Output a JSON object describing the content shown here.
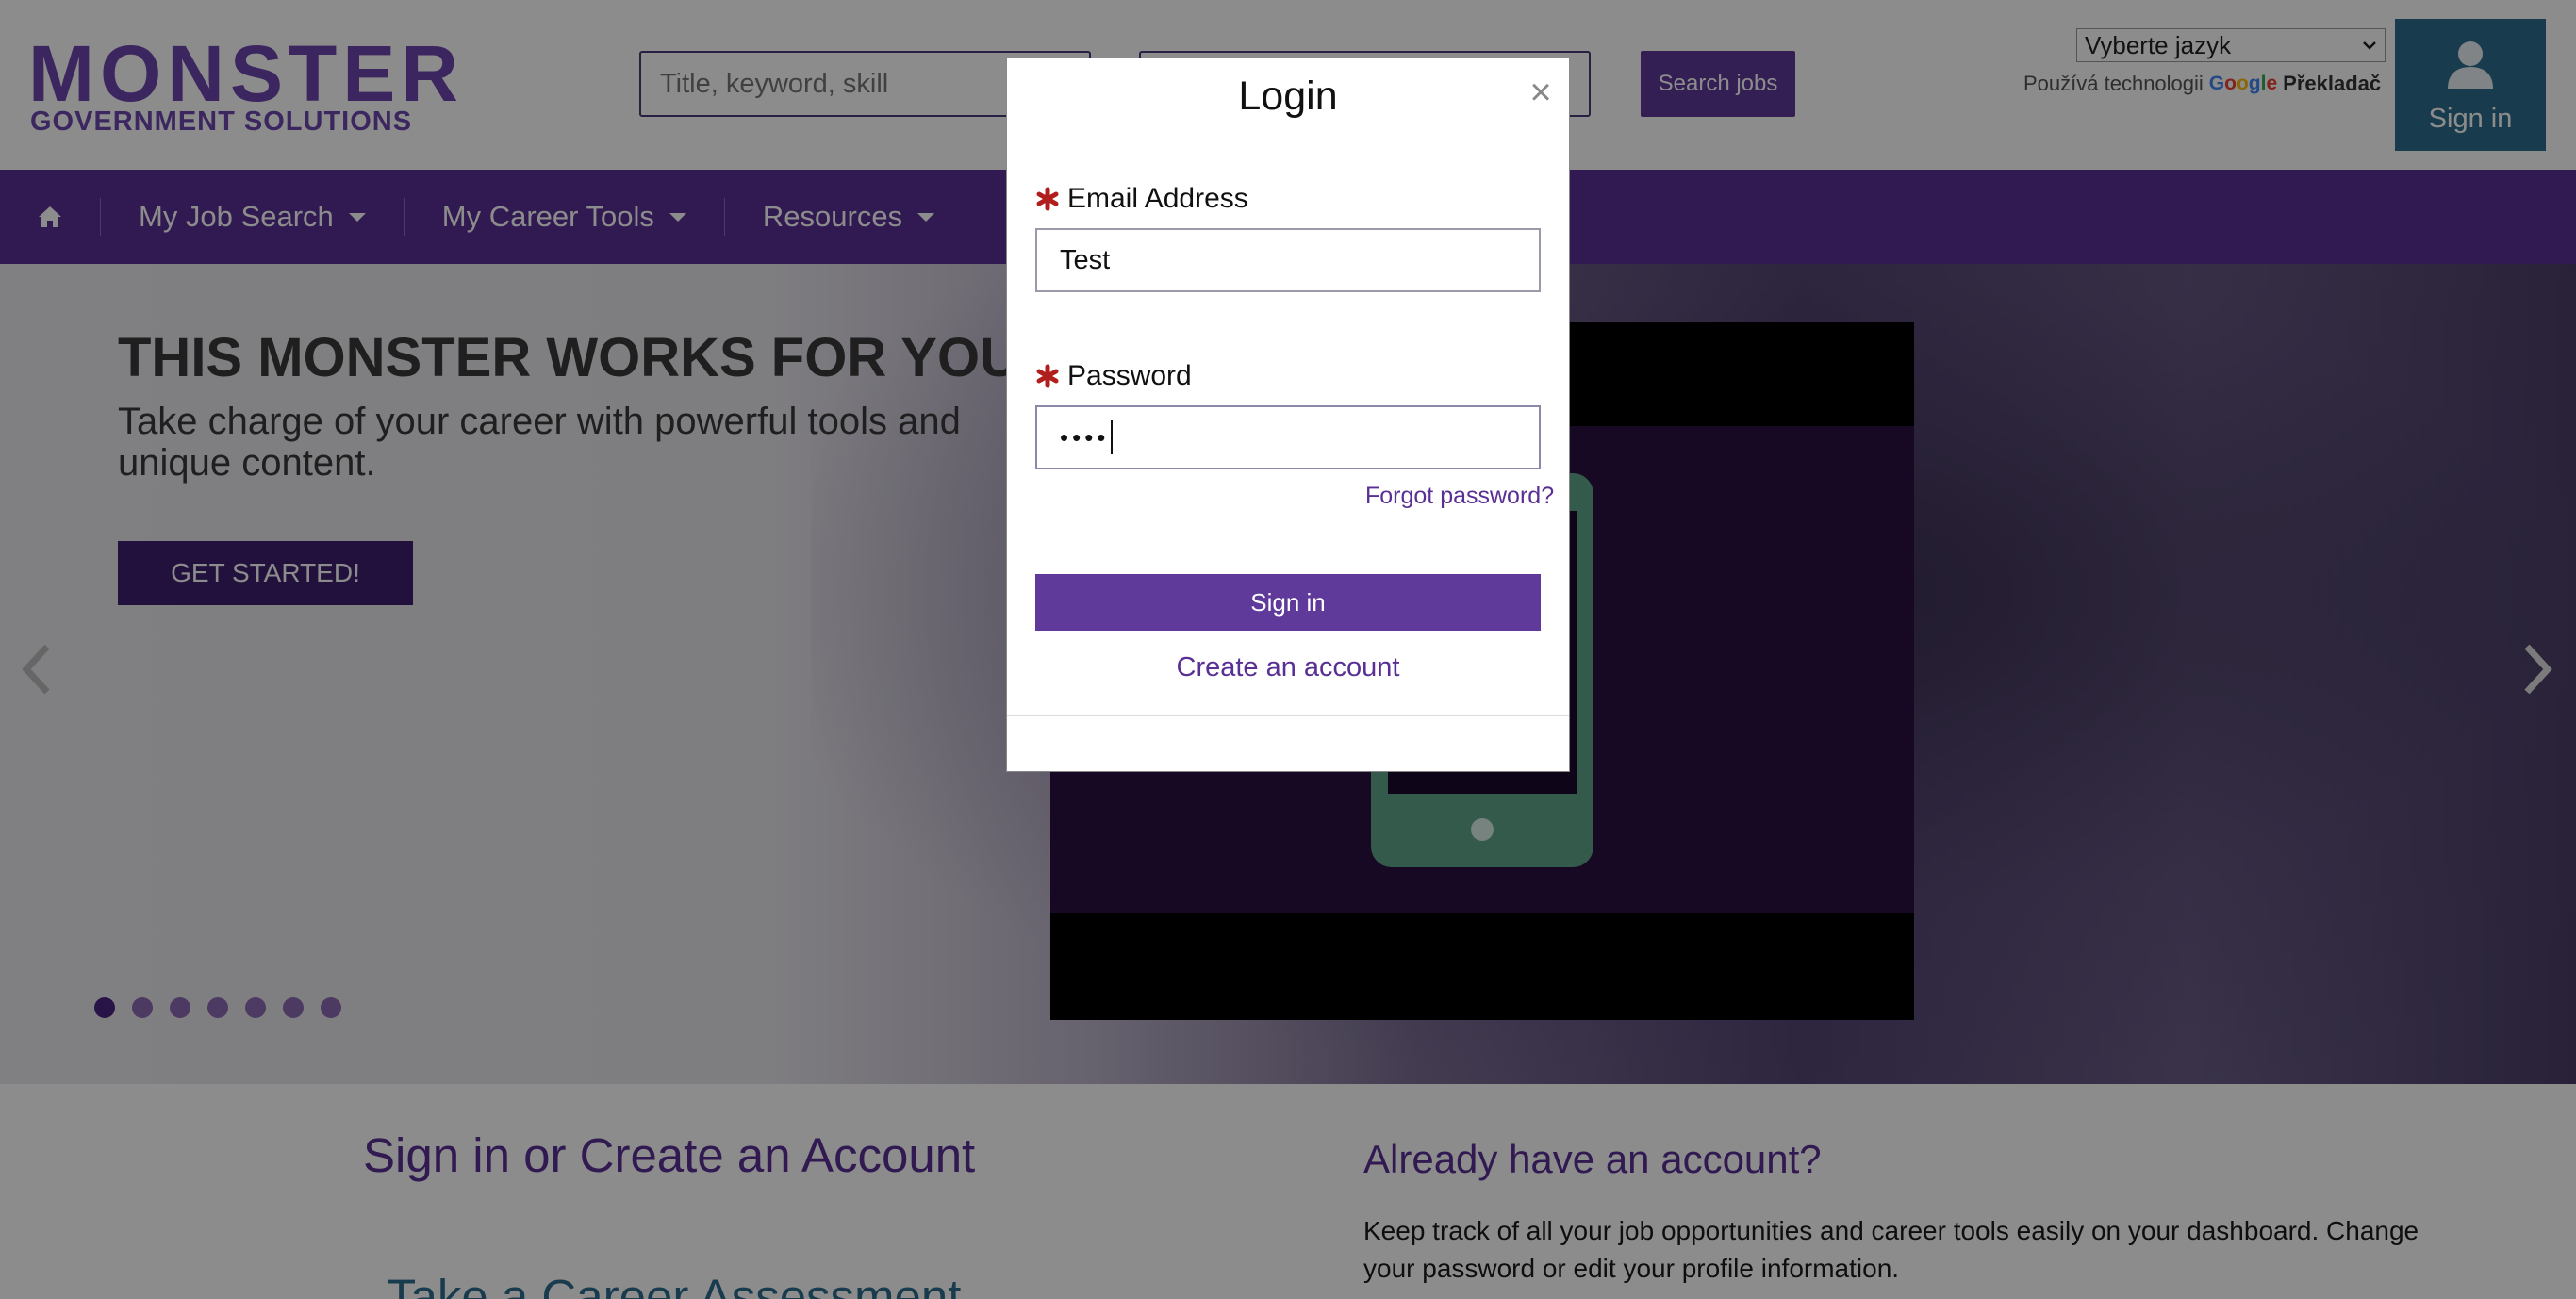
{
  "header": {
    "logo_main": "MONSTER",
    "logo_sub": "GOVERNMENT SOLUTIONS",
    "search_what_placeholder": "Title, keyword, skill",
    "search_where_placeholder": "",
    "search_button": "Search jobs",
    "language_select_value": "Vyberte jazyk",
    "powered_by": "Používá technologii",
    "google_letters": [
      "G",
      "o",
      "o",
      "g",
      "l",
      "e"
    ],
    "translate_label": "Překladač",
    "signin_tile_label": "Sign in",
    "signin_tile_color": "#2d6e8e"
  },
  "nav": {
    "items": [
      {
        "label": "My Job Search"
      },
      {
        "label": "My Career Tools"
      },
      {
        "label": "Resources"
      }
    ],
    "home_icon": "home-icon",
    "color": "#5a2f94"
  },
  "hero": {
    "title": "THIS MONSTER WORKS FOR YOU!",
    "subtitle": "Take charge of your career with powerful tools and unique content.",
    "cta_label": "GET STARTED!",
    "slide_count": 7,
    "active_slide": 1
  },
  "lower": {
    "left_title": "Sign in or Create an Account",
    "left_subtitle": "Take a Career Assessment",
    "right_title": "Already have an account?",
    "right_text": "Keep track of all your job opportunities and career tools easily on your dashboard. Change your password or edit your profile information."
  },
  "modal": {
    "title": "Login",
    "close_glyph": "×",
    "email_label": "Email Address",
    "email_value": "Test",
    "password_label": "Password",
    "password_masked": "••••",
    "forgot_label": "Forgot password?",
    "signin_label": "Sign in",
    "create_account_label": "Create an account",
    "required_color": "#b01e1e",
    "accent_color": "#5f3a9a"
  }
}
